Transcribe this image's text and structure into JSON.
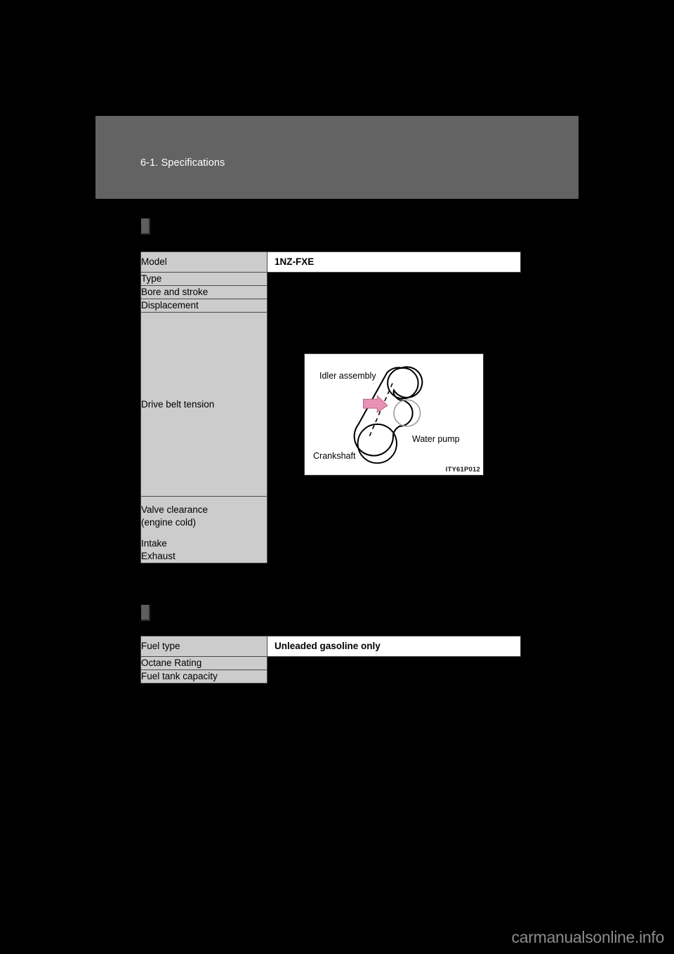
{
  "header": {
    "title": "6-1. Specifications"
  },
  "engine_section": {
    "marker": "section-marker",
    "rows": [
      {
        "label": "Model",
        "value": "1NZ-FXE",
        "value_filled": true
      },
      {
        "label": "Type",
        "value": "",
        "value_filled": false
      },
      {
        "label": "Bore and stroke",
        "value": "",
        "value_filled": false
      },
      {
        "label": "Displacement",
        "value": "",
        "value_filled": false
      },
      {
        "label": "Drive belt tension",
        "value": "",
        "value_filled": false
      },
      {
        "label": "Valve clearance\n(engine cold)",
        "value": "",
        "value_filled": false
      }
    ],
    "valve_clearance": {
      "line1": "Valve clearance",
      "line2": "(engine cold)",
      "line3": "Intake",
      "line4": "Exhaust"
    },
    "drive_belt_label": "Drive belt tension"
  },
  "belt_diagram": {
    "idler_label": "Idler assembly",
    "water_pump_label": "Water pump",
    "crankshaft_label": "Crankshaft",
    "image_code": "ITY61P012",
    "arrow_color": "#e891b4",
    "line_color": "#000000"
  },
  "fuel_section": {
    "rows": [
      {
        "label": "Fuel type",
        "value": "Unleaded gasoline only",
        "value_filled": true
      },
      {
        "label": "Octane Rating",
        "value": "",
        "value_filled": false
      },
      {
        "label": "Fuel tank capacity",
        "value": "",
        "value_filled": false
      }
    ]
  },
  "footer": {
    "watermark": "carmanualsonline.info"
  },
  "colors": {
    "page_background": "#000000",
    "header_band": "#636363",
    "label_cell": "#cccccc",
    "value_cell": "#ffffff",
    "border": "#4a4a4a"
  }
}
